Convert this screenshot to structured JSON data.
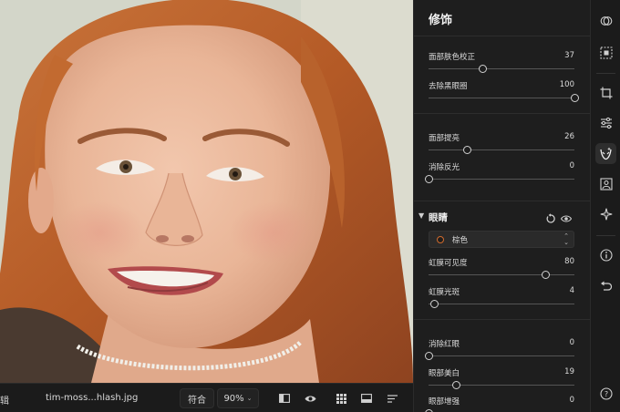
{
  "toolbar": {
    "left_edge_text": "辑",
    "file_name": "tim-moss...hlash.jpg",
    "fit_label": "符合",
    "zoom_level": "90%",
    "icons": [
      "compare-icon",
      "preview-eye-icon",
      "grid-view-icon",
      "filmstrip-icon",
      "sort-icon"
    ]
  },
  "panel": {
    "title": "修饰",
    "face": [
      {
        "label": "面部肤色校正",
        "value": "37",
        "level": 37
      },
      {
        "label": "去除黑眼圈",
        "value": "100",
        "level": 100
      },
      {
        "label": "面部提亮",
        "value": "26",
        "level": 26
      },
      {
        "label": "消除反光",
        "value": "0",
        "level": 0
      }
    ],
    "eyes": {
      "title": "眼睛",
      "color_dropdown": "棕色",
      "sliders": [
        {
          "label": "虹膜可见度",
          "value": "80",
          "level": 80
        },
        {
          "label": "虹膜光斑",
          "value": "4",
          "level": 4
        },
        {
          "label": "消除红眼",
          "value": "0",
          "level": 0
        },
        {
          "label": "眼部美白",
          "value": "19",
          "level": 19
        },
        {
          "label": "眼部增强",
          "value": "0",
          "level": 0
        }
      ]
    }
  },
  "rail": {
    "icons": [
      "layers-icon",
      "selection-icon",
      "crop-icon",
      "adjust-sliders-icon",
      "retouch-face-icon",
      "portrait-icon",
      "magic-sparkle-icon",
      "info-icon",
      "undo-icon",
      "help-icon"
    ],
    "active": "retouch-face-icon",
    "help_label": "?"
  },
  "colors": {
    "accent_iris": "#d06a2c",
    "panel_bg": "#1e1e1e",
    "rail_bg": "#1b1b1b"
  }
}
